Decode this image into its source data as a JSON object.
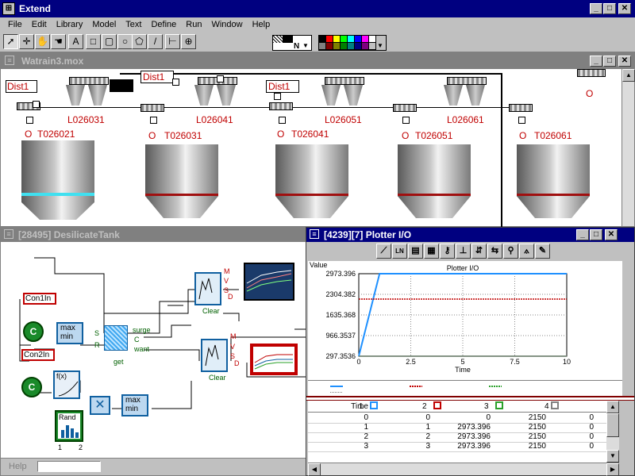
{
  "app": {
    "title": "Extend"
  },
  "menu": [
    "File",
    "Edit",
    "Library",
    "Model",
    "Text",
    "Define",
    "Run",
    "Window",
    "Help"
  ],
  "toolbar": {
    "tools": [
      "arrow-tool",
      "pointer-add-tool",
      "cursor-tool",
      "hand-tool",
      "text-tool",
      "rectangle-tool",
      "rounded-rect-tool",
      "oval-tool",
      "polygon-tool",
      "line-tool",
      "connector-tool",
      "clone-tool"
    ],
    "tool_glyphs": [
      "➚",
      "✛",
      "✋",
      "☚",
      "A",
      "□",
      "▢",
      "○",
      "⬠",
      "/",
      "⊢",
      "⊕"
    ],
    "line_style_label": "N",
    "palette_colors": [
      "#000000",
      "#ff0000",
      "#ffff00",
      "#00ff00",
      "#00ffff",
      "#0000ff",
      "#ff00ff",
      "#ffffff",
      "#808080",
      "#800000",
      "#808000",
      "#008000",
      "#008080",
      "#000080",
      "#800080",
      "#c0c0c0"
    ]
  },
  "model_window": {
    "title": "Watrain3.mox",
    "dist_labels": [
      "Dist1",
      "Dist1",
      "Dist1"
    ],
    "line_labels": [
      "L026031",
      "L026041",
      "L026051",
      "L026061"
    ],
    "tank_labels": [
      "T026021",
      "T026031",
      "T026041",
      "T026051",
      "T026061"
    ],
    "circle_marks": [
      "O",
      "O",
      "O",
      "O",
      "O",
      "O"
    ]
  },
  "desiccant_window": {
    "title": "[28495]  DesilicateTank",
    "inputs": [
      "Con1In",
      "Con2In"
    ],
    "constant_label": "C",
    "maxmin_label_max": "max",
    "maxmin_label_min": "min",
    "fx_label": "f(x)",
    "rand_label": "Rand",
    "ports": {
      "surge": "surge",
      "c": "C",
      "want": "want",
      "get": "get",
      "s": "S",
      "r": "R"
    },
    "plotter_ports": [
      "M",
      "V",
      "S",
      "D"
    ],
    "clear_label": "Clear",
    "fx_small": "1",
    "rand_small": "2",
    "help_label": "Help"
  },
  "plotter_window": {
    "title": "[4239][7]  Plotter I/O",
    "tools": [
      "line-plot-icon",
      "ln-icon",
      "format-icon",
      "grid-icon",
      "key-icon",
      "axis-icon",
      "zoom-icon",
      "magnify-icon",
      "trace-icon",
      "pen-icon",
      "hand-icon"
    ],
    "tool_glyphs": [
      "⟋",
      "LN",
      "▤",
      "▦",
      "⚷",
      "⊥",
      "⇵",
      "⇆",
      "⚲",
      "⟑",
      "✎",
      "☝"
    ],
    "ln_label": "LN",
    "table_headers": [
      "Time",
      "1",
      "2",
      "3",
      "4"
    ]
  },
  "chart_data": {
    "type": "line",
    "title": "Plotter I/O",
    "ylabel": "Value",
    "xlabel": "Time",
    "xlim": [
      0,
      10
    ],
    "ylim": [
      297.3,
      2973.396
    ],
    "x_ticks": [
      "0",
      "2.5",
      "5",
      "7.5",
      "10"
    ],
    "y_ticks": [
      "2973.396",
      "2304.382",
      "1635.368",
      "966.3537",
      "297.3536"
    ],
    "grid": true,
    "series": [
      {
        "name": "1",
        "color": "#1e90ff",
        "x": [
          0,
          1,
          2,
          3,
          10
        ],
        "y": [
          0,
          2973.396,
          2973.396,
          2973.396,
          2973.396
        ]
      },
      {
        "name": "2",
        "color": "#c00000",
        "x": [
          0,
          10
        ],
        "y": [
          2150,
          2150
        ]
      },
      {
        "name": "3",
        "color": "#2aa02a",
        "x": [
          0,
          10
        ],
        "y": [
          0,
          0
        ]
      },
      {
        "name": "4",
        "color": "#808080",
        "x": [
          0,
          10
        ],
        "y": [
          0,
          0
        ]
      }
    ],
    "table_rows": [
      [
        "0",
        "0",
        "2150",
        "0"
      ],
      [
        "1",
        "2973.396",
        "2150",
        "0"
      ],
      [
        "2",
        "2973.396",
        "2150",
        "0"
      ],
      [
        "3",
        "2973.396",
        "2150",
        "0"
      ]
    ]
  }
}
